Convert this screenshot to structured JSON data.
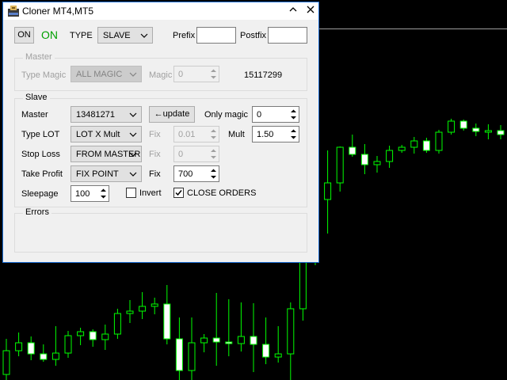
{
  "window": {
    "title": "Cloner MT4,MT5",
    "minimize_glyph": "⌃",
    "close_glyph": "✕"
  },
  "top": {
    "on_button": "ON",
    "status": "ON",
    "status_color": "#00a000",
    "type_label": "TYPE",
    "type_value": "SLAVE",
    "prefix_label": "Prefix",
    "prefix_value": "",
    "postfix_label": "Postfix",
    "postfix_value": ""
  },
  "master": {
    "title": "Master",
    "type_magic_label": "Type Magic",
    "type_magic_value": "ALL MAGIC",
    "magic_label": "Magic",
    "magic_value": "0",
    "account": "15117299"
  },
  "slave": {
    "title": "Slave",
    "master_label": "Master",
    "master_value": "13481271",
    "update_button": "update",
    "only_magic_label": "Only magic",
    "only_magic_value": "0",
    "type_lot_label": "Type LOT",
    "type_lot_value": "LOT X Mult",
    "fix_label": "Fix",
    "lot_fix_value": "0.01",
    "mult_label": "Mult",
    "mult_value": "1.50",
    "stop_loss_label": "Stop Loss",
    "stop_loss_value": "FROM MASTER",
    "sl_fix_value": "0",
    "take_profit_label": "Take Profit",
    "take_profit_value": "FIX POINT",
    "tp_fix_value": "700",
    "sleepage_label": "Sleepage",
    "sleepage_value": "100",
    "invert_label": "Invert",
    "invert_checked": false,
    "close_orders_label": "CLOSE ORDERS",
    "close_orders_checked": true
  },
  "errors": {
    "title": "Errors"
  },
  "colors": {
    "chart_bg": "#000000",
    "candle": "#00ff00",
    "window_border": "#1d6fd6",
    "panel": "#f0f0f0"
  },
  "chart": {
    "candles": [
      {
        "o": 7,
        "h": 52,
        "l": 0,
        "c": 37,
        "bull": true
      },
      {
        "o": 37,
        "h": 60,
        "l": 30,
        "c": 47,
        "bull": true
      },
      {
        "o": 47,
        "h": 55,
        "l": 25,
        "c": 33,
        "bull": false
      },
      {
        "o": 33,
        "h": 45,
        "l": 23,
        "c": 26,
        "bull": false
      },
      {
        "o": 26,
        "h": 68,
        "l": 18,
        "c": 34,
        "bull": true
      },
      {
        "o": 34,
        "h": 62,
        "l": 28,
        "c": 56,
        "bull": true
      },
      {
        "o": 56,
        "h": 66,
        "l": 44,
        "c": 61,
        "bull": true
      },
      {
        "o": 61,
        "h": 64,
        "l": 42,
        "c": 51,
        "bull": false
      },
      {
        "o": 51,
        "h": 70,
        "l": 38,
        "c": 58,
        "bull": true
      },
      {
        "o": 58,
        "h": 90,
        "l": 52,
        "c": 84,
        "bull": true
      },
      {
        "o": 84,
        "h": 101,
        "l": 72,
        "c": 87,
        "bull": true
      },
      {
        "o": 87,
        "h": 111,
        "l": 77,
        "c": 93,
        "bull": true
      },
      {
        "o": 93,
        "h": 104,
        "l": 83,
        "c": 96,
        "bull": true
      },
      {
        "o": 96,
        "h": 120,
        "l": 45,
        "c": 52,
        "bull": false
      },
      {
        "o": 52,
        "h": 79,
        "l": 0,
        "c": 12,
        "bull": false
      },
      {
        "o": 12,
        "h": 79,
        "l": 0,
        "c": 47,
        "bull": true
      },
      {
        "o": 47,
        "h": 58,
        "l": 35,
        "c": 53,
        "bull": true
      },
      {
        "o": 53,
        "h": 110,
        "l": 18,
        "c": 48,
        "bull": false
      },
      {
        "o": 48,
        "h": 102,
        "l": 30,
        "c": 46,
        "bull": false
      },
      {
        "o": 46,
        "h": 98,
        "l": 36,
        "c": 55,
        "bull": true
      },
      {
        "o": 55,
        "h": 97,
        "l": 10,
        "c": 45,
        "bull": false
      },
      {
        "o": 45,
        "h": 79,
        "l": 20,
        "c": 29,
        "bull": false
      },
      {
        "o": 29,
        "h": 68,
        "l": 22,
        "c": 33,
        "bull": true
      },
      {
        "o": 33,
        "h": 98,
        "l": 0,
        "c": 90,
        "bull": true
      },
      {
        "o": 90,
        "h": 175,
        "l": 75,
        "c": 150,
        "bull": true
      },
      {
        "o": 150,
        "h": 290,
        "l": 145,
        "c": 228,
        "bull": true
      },
      {
        "o": 228,
        "h": 290,
        "l": 185,
        "c": 249,
        "bull": true
      },
      {
        "o": 249,
        "h": 295,
        "l": 238,
        "c": 294,
        "bull": true
      },
      {
        "o": 294,
        "h": 310,
        "l": 282,
        "c": 285,
        "bull": false
      },
      {
        "o": 285,
        "h": 298,
        "l": 260,
        "c": 272,
        "bull": false
      },
      {
        "o": 272,
        "h": 283,
        "l": 262,
        "c": 276,
        "bull": true
      },
      {
        "o": 276,
        "h": 296,
        "l": 268,
        "c": 290,
        "bull": true
      },
      {
        "o": 290,
        "h": 297,
        "l": 287,
        "c": 294,
        "bull": true
      },
      {
        "o": 294,
        "h": 307,
        "l": 286,
        "c": 302,
        "bull": true
      },
      {
        "o": 302,
        "h": 306,
        "l": 287,
        "c": 290,
        "bull": false
      },
      {
        "o": 290,
        "h": 316,
        "l": 286,
        "c": 313,
        "bull": true
      },
      {
        "o": 313,
        "h": 330,
        "l": 310,
        "c": 327,
        "bull": true
      },
      {
        "o": 327,
        "h": 329,
        "l": 315,
        "c": 318,
        "bull": false
      },
      {
        "o": 318,
        "h": 324,
        "l": 308,
        "c": 314,
        "bull": false
      },
      {
        "o": 314,
        "h": 323,
        "l": 304,
        "c": 315,
        "bull": true
      },
      {
        "o": 315,
        "h": 322,
        "l": 304,
        "c": 310,
        "bull": false
      }
    ]
  }
}
